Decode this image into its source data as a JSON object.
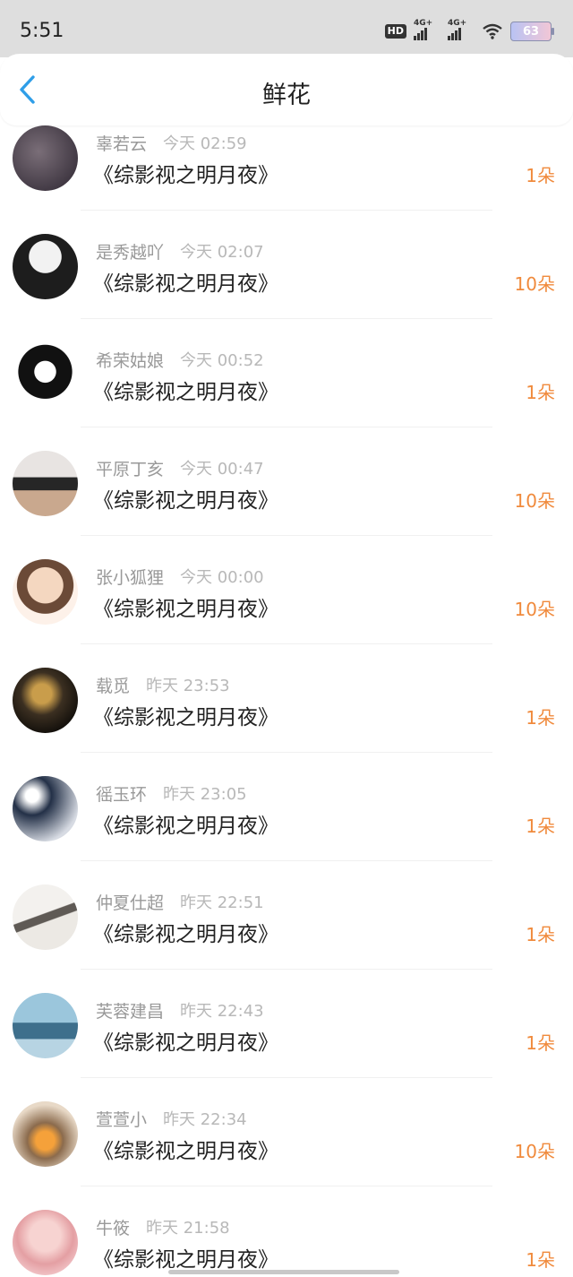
{
  "status_bar": {
    "time": "5:51",
    "hd": "HD",
    "net1": "4G+",
    "net2": "4G+",
    "battery": "63"
  },
  "header": {
    "title": "鲜花",
    "back_icon": "chevron-left-icon"
  },
  "entries": [
    {
      "name": "辜若云",
      "time": "今天 02:59",
      "book": "《综影视之明月夜》",
      "count": "1朵"
    },
    {
      "name": "是秀越吖",
      "time": "今天 02:07",
      "book": "《综影视之明月夜》",
      "count": "10朵"
    },
    {
      "name": "希荣姑娘",
      "time": "今天 00:52",
      "book": "《综影视之明月夜》",
      "count": "1朵"
    },
    {
      "name": "平原丁亥",
      "time": "今天 00:47",
      "book": "《综影视之明月夜》",
      "count": "10朵"
    },
    {
      "name": "张小狐狸",
      "time": "今天 00:00",
      "book": "《综影视之明月夜》",
      "count": "10朵"
    },
    {
      "name": "载觅",
      "time": "昨天 23:53",
      "book": "《综影视之明月夜》",
      "count": "1朵"
    },
    {
      "name": "徭玉环",
      "time": "昨天 23:05",
      "book": "《综影视之明月夜》",
      "count": "1朵"
    },
    {
      "name": "仲夏仕超",
      "time": "昨天 22:51",
      "book": "《综影视之明月夜》",
      "count": "1朵"
    },
    {
      "name": "芙蓉建昌",
      "time": "昨天 22:43",
      "book": "《综影视之明月夜》",
      "count": "1朵"
    },
    {
      "name": "萱萱小",
      "time": "昨天 22:34",
      "book": "《综影视之明月夜》",
      "count": "10朵"
    },
    {
      "name": "牛筱",
      "time": "昨天 21:58",
      "book": "《综影视之明月夜》",
      "count": "1朵"
    }
  ],
  "colors": {
    "accent_blue": "#2f9ee8",
    "count_orange": "#f08a3c",
    "status_bar_bg": "#dedede"
  }
}
